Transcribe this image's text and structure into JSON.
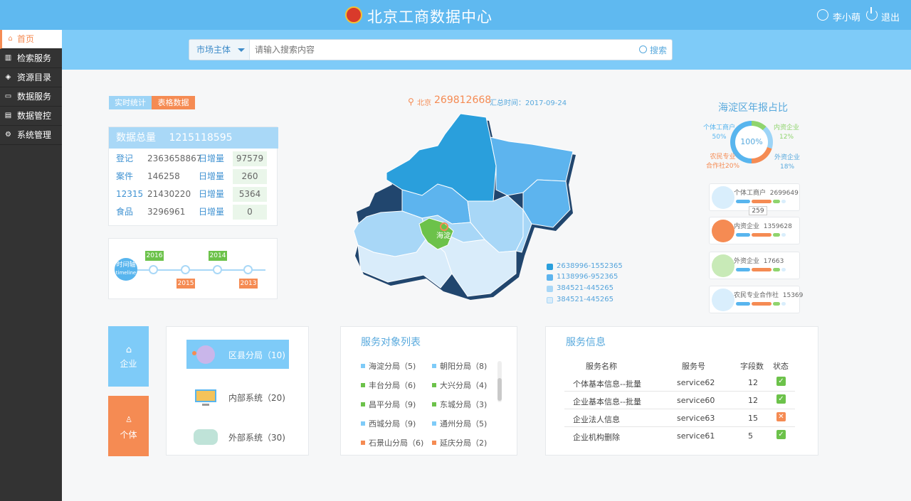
{
  "header": {
    "title": "北京工商数据中心",
    "user": "李小萌",
    "logout": "退出"
  },
  "sidebar": {
    "items": [
      {
        "label": "首页",
        "icon": "home-icon",
        "active": true
      },
      {
        "label": "检索服务",
        "icon": "chart-icon"
      },
      {
        "label": "资源目录",
        "icon": "layers-icon"
      },
      {
        "label": "数据服务",
        "icon": "monitor-icon"
      },
      {
        "label": "数据管控",
        "icon": "document-icon"
      },
      {
        "label": "系统管理",
        "icon": "gear-icon"
      }
    ]
  },
  "search": {
    "select_label": "市场主体",
    "placeholder": "请输入搜索内容",
    "button": "搜索"
  },
  "tabs": {
    "realtime": "实时统计",
    "table": "表格数据"
  },
  "totals": {
    "title": "数据总量",
    "value": "1215118595",
    "rows": [
      {
        "label": "登记",
        "value": "2363658867",
        "delta_label": "日增量",
        "delta": "97579"
      },
      {
        "label": "案件",
        "value": "146258",
        "delta_label": "日增量",
        "delta": "260"
      },
      {
        "label": "12315",
        "value": "21430220",
        "delta_label": "日增量",
        "delta": "5364"
      },
      {
        "label": "食品",
        "value": "3296961",
        "delta_label": "日增量",
        "delta": "0"
      }
    ]
  },
  "timeline": {
    "title": "时间轴",
    "subtitle": "timeline",
    "years": [
      "2016",
      "2015",
      "2014",
      "2013"
    ]
  },
  "map": {
    "city": "北京",
    "count": "269812668",
    "date_label": "汇总时间：2017-09-24",
    "highlight": "海淀",
    "legend": [
      {
        "label": "2638996-1552365",
        "color": "#2a9fdc"
      },
      {
        "label": "1138996-952365",
        "color": "#5db4ee"
      },
      {
        "label": "384521-445265",
        "color": "#a8d7f7"
      },
      {
        "label": "384521-445265",
        "color": "#d9ecfa"
      }
    ]
  },
  "pie": {
    "title": "海淀区年报占比",
    "center": "100%",
    "slices": [
      {
        "name": "个体工商户",
        "pct": "50%",
        "value": 50,
        "color": "#58b5ee"
      },
      {
        "name": "内资企业",
        "pct": "12%",
        "value": 12,
        "color": "#8fd46d"
      },
      {
        "name": "农民专业合作社",
        "pct": "20%",
        "value": 20,
        "color": "#f58b53"
      },
      {
        "name": "外资企业",
        "pct": "18%",
        "value": 18,
        "color": "#58a9dd"
      }
    ],
    "labels": {
      "a": "个体工商户",
      "a_pct": "50%",
      "b": "内资企业",
      "b_pct": "12%",
      "c1": "农民专业",
      "c2": "合作社20%",
      "d": "外资企业",
      "d_pct": "18%"
    }
  },
  "entities": [
    {
      "name": "个体工商户",
      "value": "2699649",
      "color": "#7ecbf8",
      "icon": "clipboard-icon"
    },
    {
      "name": "内资企业",
      "value": "1359628",
      "color": "#f58b53",
      "icon": "layers-icon"
    },
    {
      "name": "外资企业",
      "value": "17663",
      "color": "#8fd46d",
      "icon": "box-icon"
    },
    {
      "name": "农民专业合作社",
      "value": "15369",
      "color": "#9cd4f7",
      "icon": "leaf-icon"
    }
  ],
  "tooltip": "259",
  "quick": {
    "enterprise": "企业",
    "individual": "个体"
  },
  "categories": [
    {
      "label": "区县分局（10)",
      "selected": true
    },
    {
      "label": "内部系统（20)"
    },
    {
      "label": "外部系统（30)"
    }
  ],
  "service_list": {
    "title": "服务对象列表",
    "items": [
      {
        "text": "海淀分局（5)",
        "color": "#7ecbf8"
      },
      {
        "text": "朝阳分局（8)",
        "color": "#7ecbf8"
      },
      {
        "text": "丰台分局（6)",
        "color": "#6cc24a"
      },
      {
        "text": "大兴分局（4)",
        "color": "#6cc24a"
      },
      {
        "text": "昌平分局（9)",
        "color": "#6cc24a"
      },
      {
        "text": "东城分局（3)",
        "color": "#6cc24a"
      },
      {
        "text": "西城分局（9)",
        "color": "#7ecbf8"
      },
      {
        "text": "通州分局（5)",
        "color": "#7ecbf8"
      },
      {
        "text": "石景山分局（6)",
        "color": "#f58b53"
      },
      {
        "text": "延庆分局（2)",
        "color": "#f58b53"
      }
    ]
  },
  "service_info": {
    "title": "服务信息",
    "headers": [
      "服务名称",
      "服务号",
      "字段数",
      "状态"
    ],
    "rows": [
      {
        "name": "个体基本信息--批量",
        "id": "service62",
        "fields": "12",
        "status": "ok"
      },
      {
        "name": "企业基本信息--批量",
        "id": "service60",
        "fields": "12",
        "status": "ok"
      },
      {
        "name": "企业法人信息",
        "id": "service63",
        "fields": "15",
        "status": "error"
      },
      {
        "name": "企业机构删除",
        "id": "service61",
        "fields": "5",
        "status": "ok"
      }
    ]
  }
}
